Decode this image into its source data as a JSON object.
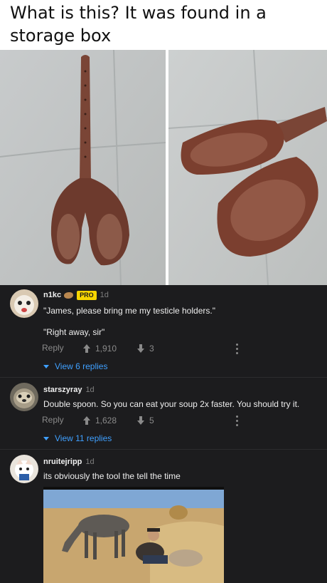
{
  "post": {
    "title": "What is this? It was found in a storage box"
  },
  "comments": [
    {
      "username": "n1kc",
      "badge": "PRO",
      "time": "1d",
      "text_line1": "\"James, please bring me my testicle holders.\"",
      "text_line2": "\"Right away, sir\"",
      "reply_label": "Reply",
      "upvotes": "1,910",
      "downvotes": "3",
      "view_replies": "View 6 replies"
    },
    {
      "username": "starszyray",
      "time": "1d",
      "text": "Double spoon. So you can eat your soup 2x faster. You should try it.",
      "reply_label": "Reply",
      "upvotes": "1,628",
      "downvotes": "5",
      "view_replies": "View 11 replies"
    },
    {
      "username": "nruitejripp",
      "time": "1d",
      "text": "its obviously the tool the tell the time"
    }
  ],
  "colors": {
    "dark_bg": "#1c1c1e",
    "link_blue": "#3fa0ff",
    "pro_badge": "#f6d500"
  },
  "icons": {
    "upvote": "arrow-up-icon",
    "downvote": "arrow-down-icon",
    "more": "more-vertical-icon",
    "expand": "caret-down-icon"
  }
}
